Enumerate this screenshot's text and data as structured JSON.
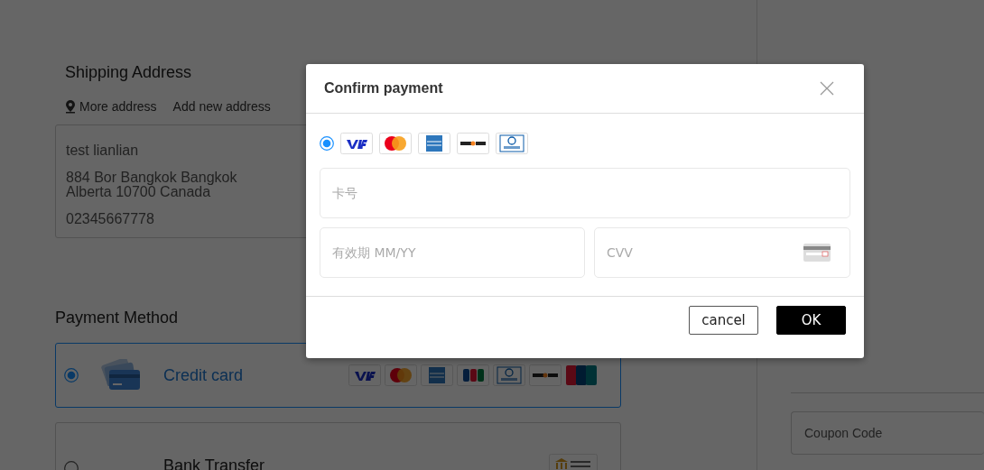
{
  "shipping": {
    "title": "Shipping Address",
    "links": [
      "More address",
      "Add new address"
    ],
    "address": {
      "name": "test lianlian",
      "lines": [
        "884 Bor Bangkok Bangkok",
        "Alberta 10700 Canada"
      ],
      "phone": "02345667778"
    }
  },
  "payment": {
    "title": "Payment Method",
    "methods": [
      {
        "kind": "card",
        "label": "Credit card",
        "selected": true
      },
      {
        "kind": "bank",
        "label": "Bank Transfer",
        "selected": false
      }
    ]
  },
  "sidebar": {
    "coupon": {
      "placeholder": "Coupon Code"
    }
  },
  "dialog": {
    "title": "Confirm payment",
    "card_option": {
      "selected": true
    },
    "fields": [
      {
        "placeholder": "卡号"
      },
      {
        "placeholder": "有效期 MM/YY"
      },
      {
        "placeholder": "CVV"
      }
    ],
    "buttons": [
      {
        "kind": "secondary",
        "label": "cancel"
      },
      {
        "kind": "primary",
        "label": "OK"
      }
    ]
  }
}
